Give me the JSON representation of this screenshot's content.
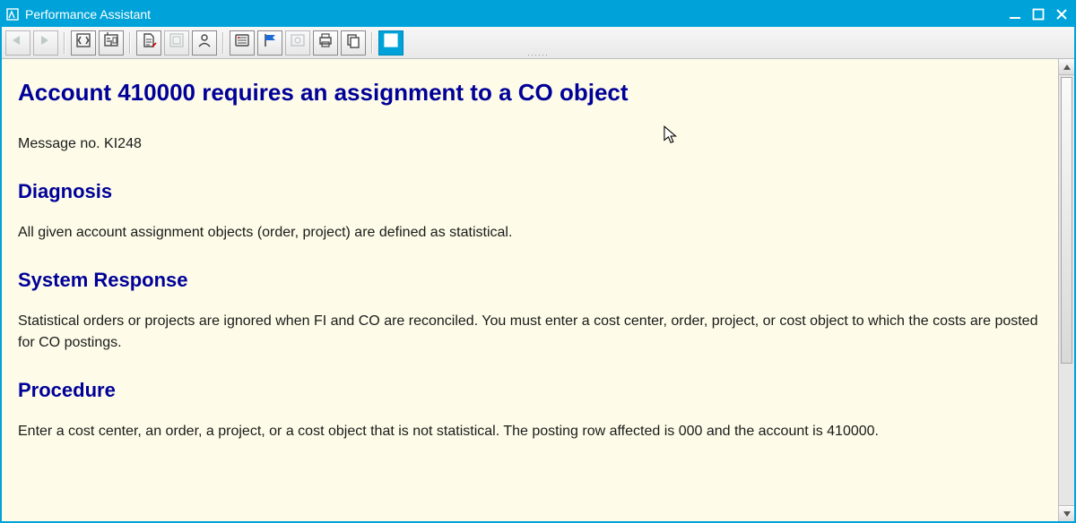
{
  "window": {
    "title": "Performance Assistant"
  },
  "toolbar": {
    "icons": [
      {
        "name": "nav-back-button",
        "label": "back-arrow",
        "disabled": true
      },
      {
        "name": "nav-forward-button",
        "label": "forward-arrow",
        "disabled": true
      },
      {
        "name": "toggle-nav-button",
        "label": "arrows-in-box",
        "disabled": false,
        "sepBefore": true
      },
      {
        "name": "tech-info-button",
        "label": "tech-info",
        "disabled": false
      },
      {
        "name": "application-help-button",
        "label": "help-doc",
        "disabled": false,
        "sepBefore": true
      },
      {
        "name": "customizing-button",
        "label": "customizing",
        "disabled": true
      },
      {
        "name": "personal-help-button",
        "label": "person",
        "disabled": false
      },
      {
        "name": "glossary-button",
        "label": "glossary",
        "disabled": false,
        "sepBefore": true
      },
      {
        "name": "flag-button",
        "label": "flag",
        "disabled": false
      },
      {
        "name": "more-help-button",
        "label": "more-help",
        "disabled": true
      },
      {
        "name": "print-button",
        "label": "print",
        "disabled": false
      },
      {
        "name": "copy-button",
        "label": "copy",
        "disabled": false
      },
      {
        "name": "close-help-button",
        "label": "close-x",
        "disabled": false,
        "active": true,
        "sepBefore": true
      }
    ]
  },
  "doc": {
    "title": "Account 410000 requires an assignment to a CO object",
    "message_no": "Message no. KI248",
    "diagnosis_heading": "Diagnosis",
    "diagnosis_body": "All given account assignment objects (order, project) are defined as statistical.",
    "system_response_heading": "System Response",
    "system_response_body": "Statistical orders or projects are ignored when FI and CO are reconciled. You must enter a cost center, order, project, or cost object to which the costs are posted for CO postings.",
    "procedure_heading": "Procedure",
    "procedure_body": "Enter a cost center, an order, a project, or a cost object that is not statistical. The posting row affected is 000 and the account is 410000."
  }
}
